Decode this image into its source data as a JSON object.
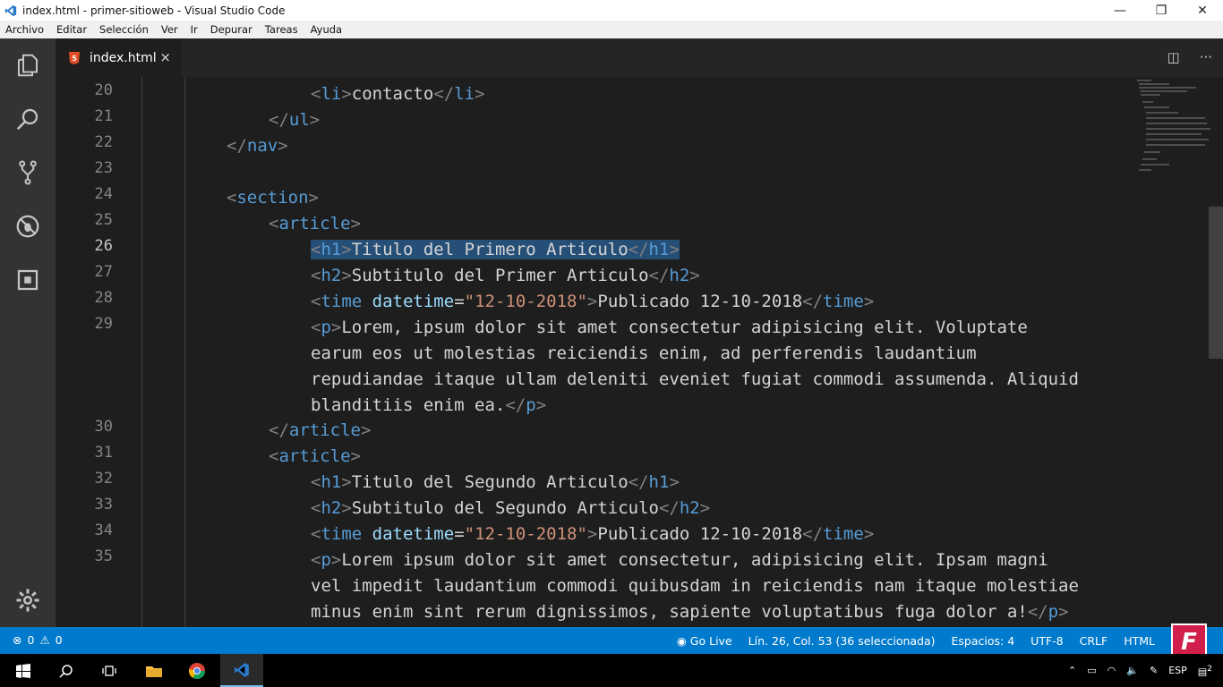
{
  "window": {
    "title": "index.html - primer-sitioweb - Visual Studio Code",
    "controls": {
      "minimize": "—",
      "restore": "❐",
      "close": "✕"
    }
  },
  "menu": [
    "Archivo",
    "Editar",
    "Selección",
    "Ver",
    "Ir",
    "Depurar",
    "Tareas",
    "Ayuda"
  ],
  "activity_bar": [
    "explorer-icon",
    "search-icon",
    "source-control-icon",
    "debug-icon",
    "extensions-icon",
    "settings-gear-icon"
  ],
  "tab": {
    "label": "index.html",
    "close": "×",
    "icon": "html5-icon"
  },
  "tab_actions": {
    "split": "◫",
    "more": "···"
  },
  "editor": {
    "active_line": "26",
    "lines": [
      {
        "n": "20"
      },
      {
        "n": "21"
      },
      {
        "n": "22"
      },
      {
        "n": "23"
      },
      {
        "n": "24"
      },
      {
        "n": "25"
      },
      {
        "n": "26"
      },
      {
        "n": "27"
      },
      {
        "n": "28"
      },
      {
        "n": "29"
      },
      {
        "n": ""
      },
      {
        "n": ""
      },
      {
        "n": ""
      },
      {
        "n": "30"
      },
      {
        "n": "31"
      },
      {
        "n": "32"
      },
      {
        "n": "33"
      },
      {
        "n": "34"
      },
      {
        "n": "35"
      }
    ],
    "code": {
      "l20_text": "contacto",
      "l26_text": "Titulo del Primero Articulo",
      "l27_text": "Subtitulo del Primer Articulo",
      "l28_attr": "datetime",
      "l28_val": "\"12-10-2018\"",
      "l28_text": "Publicado 12-10-2018",
      "l29a": "Lorem, ipsum dolor sit amet consectetur adipisicing elit. Voluptate",
      "l29b": "earum eos ut molestias reiciendis enim, ad perferendis laudantium",
      "l29c": "repudiandae itaque ullam deleniti eveniet fugiat commodi assumenda. Aliquid",
      "l29d": "blanditiis enim ea.",
      "l32_text": "Titulo del Segundo Articulo",
      "l33_text": "Subtitulo del Segundo Articulo",
      "l34_attr": "datetime",
      "l34_val": "\"12-10-2018\"",
      "l34_text": "Publicado 12-10-2018",
      "l35a": "Lorem ipsum dolor sit amet consectetur, adipisicing elit. Ipsam magni",
      "l35b": "vel impedit laudantium commodi quibusdam in reiciendis nam itaque molestiae",
      "l35c": "minus enim sint rerum dignissimos, sapiente voluptatibus fuga dolor a!"
    }
  },
  "status": {
    "errors": "0",
    "warnings": "0",
    "go_live": "Go Live",
    "position": "Lín. 26, Col. 53 (36 seleccionada)",
    "spaces": "Espacios: 4",
    "encoding": "UTF-8",
    "eol": "CRLF",
    "language": "HTML",
    "channel_logo": "F"
  },
  "taskbar": {
    "tray_lang": "ESP",
    "notifications_badge": "2"
  },
  "colors": {
    "statusbar": "#007acc",
    "tag": "#569cd6",
    "attribute": "#9cdcfe",
    "string": "#ce9178",
    "selection": "#264f78"
  }
}
